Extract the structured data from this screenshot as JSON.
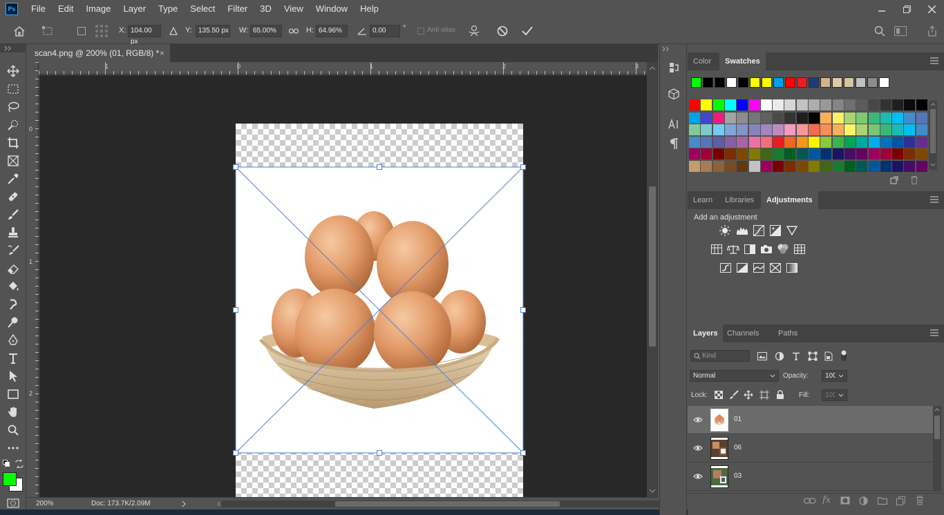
{
  "app": {
    "logo": "Ps"
  },
  "menu": [
    "File",
    "Edit",
    "Image",
    "Layer",
    "Type",
    "Select",
    "Filter",
    "3D",
    "View",
    "Window",
    "Help"
  ],
  "options": {
    "x_label": "X:",
    "x_value": "104.00 px",
    "y_label": "Y:",
    "y_value": "135.50 px",
    "w_label": "W:",
    "w_value": "65.00%",
    "h_label": "H:",
    "h_value": "64.96%",
    "angle_value": "0.00",
    "angle_unit": "°",
    "antialias_label": "Anti-alias"
  },
  "document": {
    "tab_title": "scan4.png @ 200% (01, RGB/8) *",
    "close": "×",
    "zoom": "200%",
    "doc_info": "Doc: 173.7K/2.09M",
    "ruler_top": [
      "1",
      "0",
      "1",
      "2",
      "3"
    ],
    "ruler_left": [
      "0",
      "1",
      "2"
    ]
  },
  "swatches_panel": {
    "tabs": [
      "Color",
      "Swatches"
    ],
    "active_tab": "Swatches",
    "recent": [
      "#00ff00",
      "#000000",
      "#000000",
      "#ffffff",
      "#000000",
      "#ffff00",
      "#ffff00",
      "#00a2e8",
      "#ff0000",
      "#ed1c24",
      "#1f3c7a",
      "#d3b38a",
      "#e0c9a6",
      "#d6c3a1",
      "#c0c0c0",
      "#8c8c8c",
      "#ffffff"
    ],
    "grid": [
      [
        "#ff0000",
        "#ffff00",
        "#00ff00",
        "#00ffff",
        "#0000ff",
        "#ff00ff",
        "#ffffff",
        "#ebebeb",
        "#d6d6d6",
        "#c2c2c2",
        "#adadad",
        "#999999",
        "#858585",
        "#707070",
        "#5c5c5c",
        "#474747",
        "#333333",
        "#1f1f1f",
        "#0a0a0a",
        "#000000",
        "#f7977a",
        "#f9ad81",
        "#fdc68a",
        "#fff79a",
        "#c4df9b",
        "#a3d39c"
      ],
      [
        "#00a2e8",
        "#3f48cc",
        "#ed1e79",
        "#a3a3a3",
        "#8c8c8c",
        "#767676",
        "#606060",
        "#4a4a4a",
        "#343434",
        "#1e1e1e",
        "#000000",
        "#fbaf5d",
        "#f9f06a",
        "#abd373",
        "#7bcc70",
        "#3cb878",
        "#1cbbb4",
        "#00bff3",
        "#448ccb",
        "#5574b9",
        "#605ca8",
        "#855fa8",
        "#a863a8",
        "#f06eaa",
        "#f26d7d",
        "#ed1c24"
      ],
      [
        "#82ca9c",
        "#7accc8",
        "#6dcff6",
        "#7ea7d8",
        "#8493ca",
        "#8882be",
        "#a187be",
        "#bc8cbf",
        "#f49ac2",
        "#f5989d",
        "#f26c4f",
        "#f68e55",
        "#fbaf5d",
        "#fff467",
        "#acd372",
        "#7cc576",
        "#3bb878",
        "#1abbb4",
        "#00bff3",
        "#438ccb",
        "#5574b8",
        "#605ca8",
        "#855fa8",
        "#a763a8",
        "#f06ea9",
        "#f26d7d"
      ],
      [
        "#448ccb",
        "#5574b9",
        "#605ca8",
        "#855fa8",
        "#a864a8",
        "#f06eaa",
        "#f26d7d",
        "#ed1c24",
        "#f26522",
        "#f7941d",
        "#fff200",
        "#8dc63f",
        "#39b54a",
        "#00a651",
        "#00a99d",
        "#00aeef",
        "#0072bc",
        "#0054a6",
        "#2e3192",
        "#662d91",
        "#92278f",
        "#ec008c",
        "#ed145b",
        "#9e0b0f",
        "#a0410d",
        "#a36209"
      ],
      [
        "#9e005d",
        "#9e0039",
        "#790000",
        "#7b2e00",
        "#7d4900",
        "#827b00",
        "#406618",
        "#197b30",
        "#005e20",
        "#005952",
        "#00579e",
        "#003471",
        "#1b1464",
        "#440e62",
        "#630460",
        "#9e005d",
        "#9e0039",
        "#790000",
        "#7b2e00",
        "#7d4900",
        "#827b00",
        "#406618",
        "#197b30",
        "#005e20",
        "#005952",
        "#00579e"
      ],
      [
        "#c69c6d",
        "#a67c52",
        "#8c6239",
        "#754c24",
        "#603913",
        "#c2c2c2",
        "#9e005d",
        "#790000",
        "#7b2e00",
        "#7d4900",
        "#827b00",
        "#406618",
        "#197b30",
        "#005e20",
        "#005952",
        "#00579e",
        "#003471",
        "#1b1464",
        "#440e62",
        "#630460",
        "#9e005d",
        "#9e0039",
        "#790000",
        "#7b2e00",
        "#c69c6d",
        "#998675"
      ]
    ]
  },
  "adjustments_panel": {
    "tabs": [
      "Learn",
      "Libraries",
      "Adjustments"
    ],
    "active_tab": "Adjustments",
    "heading": "Add an adjustment"
  },
  "layers_panel": {
    "tabs": [
      "Layers",
      "Channels",
      "Paths"
    ],
    "active_tab": "Layers",
    "filter_placeholder": "Kind",
    "blend_mode": "Normal",
    "opacity_label": "Opacity:",
    "opacity_value": "100%",
    "lock_label": "Lock:",
    "fill_label": "Fill:",
    "fill_value": "100%",
    "layers": [
      {
        "name": "01",
        "selected": true
      },
      {
        "name": "06",
        "selected": false
      },
      {
        "name": "03",
        "selected": false
      }
    ]
  },
  "colors": {
    "foreground": "#00ff00",
    "background": "#ffffff",
    "accent": "#31a8ff"
  }
}
